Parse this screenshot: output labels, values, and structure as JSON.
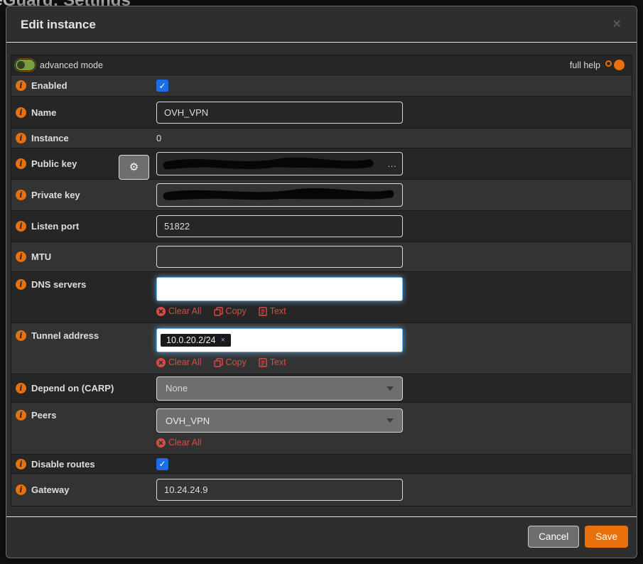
{
  "page": {
    "background_title": "WireGuard: Settings"
  },
  "colors": {
    "accent_orange": "#e8710c",
    "danger_red": "#dd4a45",
    "checkbox_blue": "#1b6ee8",
    "toggle_green": "#7b9e3f",
    "focus_blue": "#66afe9"
  },
  "icons": {
    "check": "✓",
    "gear": "⚙",
    "close": "×"
  },
  "modal": {
    "title": "Edit instance",
    "toolbar": {
      "advanced_mode_label": "advanced mode",
      "full_help_label": "full help"
    },
    "form": {
      "enabled": {
        "label": "Enabled",
        "checked": true
      },
      "name": {
        "label": "Name",
        "value": "OVH_VPN"
      },
      "instance": {
        "label": "Instance",
        "value": "0"
      },
      "public_key": {
        "label": "Public key",
        "redacted": true,
        "ellipsis": "…"
      },
      "private_key": {
        "label": "Private key",
        "redacted": true
      },
      "listen_port": {
        "label": "Listen port",
        "value": "51822"
      },
      "mtu": {
        "label": "MTU",
        "value": ""
      },
      "dns_servers": {
        "label": "DNS servers",
        "value": "",
        "actions": {
          "clear": "Clear All",
          "copy": "Copy",
          "text": "Text"
        }
      },
      "tunnel_address": {
        "label": "Tunnel address",
        "tokens": [
          "10.0.20.2/24"
        ],
        "token_remove": "×",
        "actions": {
          "clear": "Clear All",
          "copy": "Copy",
          "text": "Text"
        }
      },
      "depend_on_carp": {
        "label": "Depend on (CARP)",
        "selected": "None"
      },
      "peers": {
        "label": "Peers",
        "selected": "OVH_VPN",
        "actions": {
          "clear": "Clear All"
        }
      },
      "disable_routes": {
        "label": "Disable routes",
        "checked": true
      },
      "gateway": {
        "label": "Gateway",
        "value": "10.24.24.9"
      }
    },
    "footer": {
      "cancel_label": "Cancel",
      "save_label": "Save"
    }
  }
}
